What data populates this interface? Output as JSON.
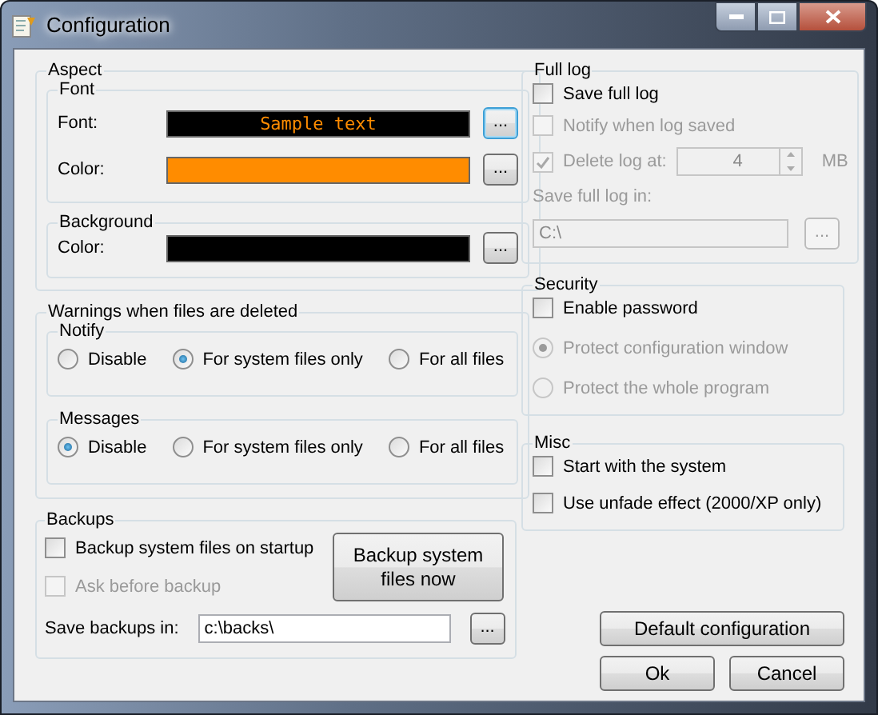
{
  "window": {
    "title": "Configuration"
  },
  "aspect": {
    "title": "Aspect",
    "font": {
      "title": "Font",
      "rows": [
        {
          "label": "Font:",
          "kind": "sample",
          "sample": "Sample text",
          "color": "#ff8c00",
          "button": "...",
          "focused": true
        },
        {
          "label": "Color:",
          "kind": "swatch",
          "color": "#ff8c00",
          "button": "...",
          "focused": false
        }
      ]
    },
    "background": {
      "title": "Background",
      "rows": [
        {
          "label": "Color:",
          "color": "#000000",
          "button": "...",
          "focused": false
        }
      ]
    }
  },
  "warnings": {
    "title": "Warnings when files are deleted",
    "groups": [
      {
        "title": "Notify",
        "options": [
          {
            "label": "Disable",
            "selected": false
          },
          {
            "label": "For system files only",
            "selected": true
          },
          {
            "label": "For all files",
            "selected": false
          }
        ]
      },
      {
        "title": "Messages",
        "options": [
          {
            "label": "Disable",
            "selected": true
          },
          {
            "label": "For system files only",
            "selected": false
          },
          {
            "label": "For all files",
            "selected": false
          }
        ]
      }
    ]
  },
  "backups": {
    "title": "Backups",
    "checks": [
      {
        "label": "Backup system files on startup",
        "checked": false,
        "disabled": false
      },
      {
        "label": "Ask before backup",
        "checked": false,
        "disabled": true
      }
    ],
    "backup_button": "Backup system files now",
    "path_label": "Save backups in:",
    "path": "c:\\backs\\",
    "browse": "..."
  },
  "full_log": {
    "title": "Full log",
    "checks": [
      {
        "label": "Save full log",
        "checked": false,
        "disabled": false
      },
      {
        "label": "Notify when log saved",
        "checked": false,
        "disabled": true
      }
    ],
    "delete": {
      "label": "Delete log at:",
      "checked": true,
      "disabled": true,
      "value": "4",
      "unit": "MB"
    },
    "path_label": "Save full log in:",
    "path": "C:\\",
    "browse": "...",
    "disabled": true
  },
  "security": {
    "title": "Security",
    "check": {
      "label": "Enable password",
      "checked": false,
      "disabled": false
    },
    "options": [
      {
        "label": "Protect configuration window",
        "selected": true,
        "disabled": true
      },
      {
        "label": "Protect the whole program",
        "selected": false,
        "disabled": true
      }
    ]
  },
  "misc": {
    "title": "Misc",
    "checks": [
      {
        "label": "Start with the system",
        "checked": false,
        "disabled": false
      },
      {
        "label": "Use unfade effect (2000/XP only)",
        "checked": false,
        "disabled": false
      }
    ]
  },
  "buttons": {
    "default": "Default configuration",
    "ok": "Ok",
    "cancel": "Cancel"
  }
}
